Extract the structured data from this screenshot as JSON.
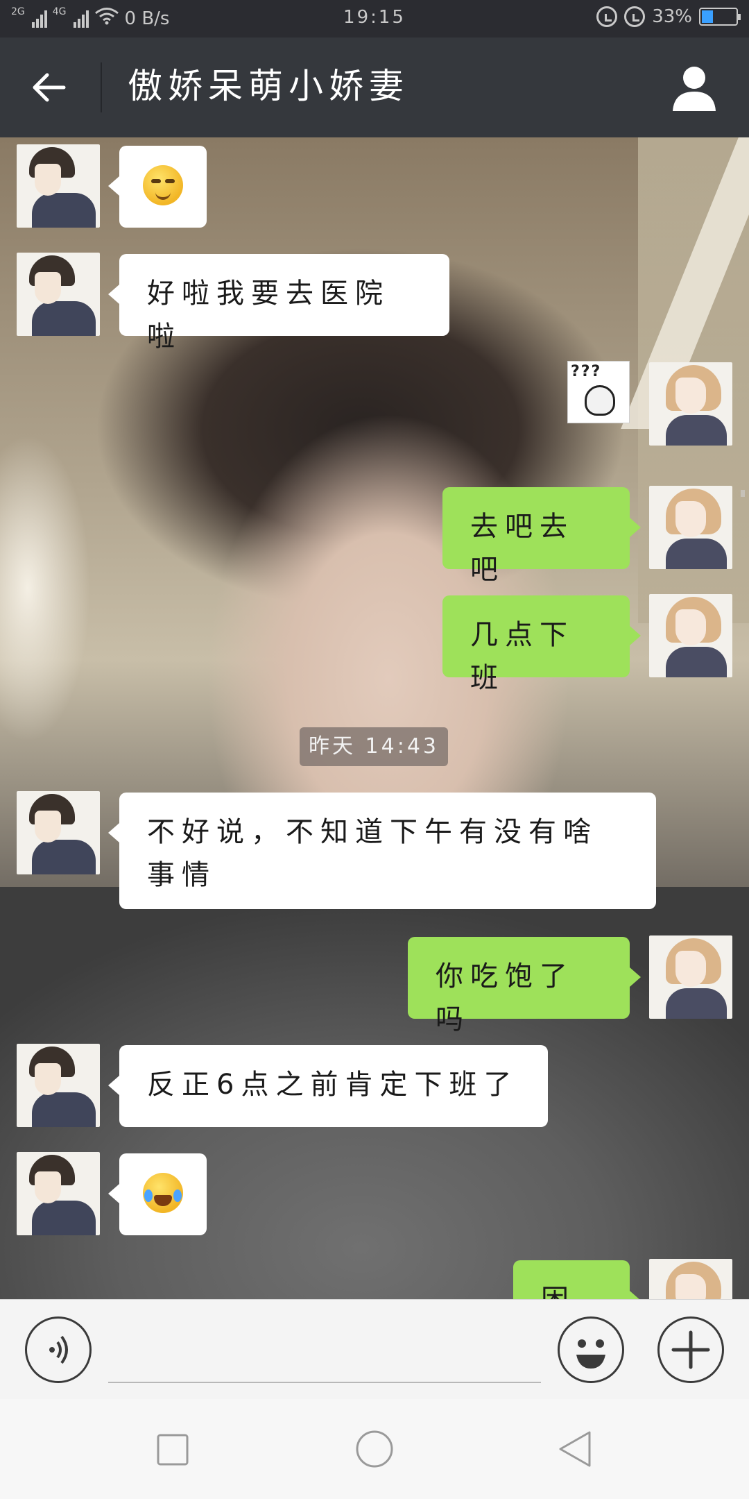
{
  "status_bar": {
    "net_type_1": "2G",
    "net_type_2": "4G",
    "speed": "0 B/s",
    "time": "19:15",
    "battery_percent": "33%",
    "battery_level": 0.33,
    "battery_color": "#3aa0ff"
  },
  "header": {
    "title": "傲娇呆萌小娇妻"
  },
  "messages": [
    {
      "side": "in",
      "type": "emoji",
      "emoji": "smirk-face"
    },
    {
      "side": "in",
      "type": "text",
      "text": "好啦我要去医院啦"
    },
    {
      "side": "out",
      "type": "sticker",
      "sticker_text": "???"
    },
    {
      "side": "out",
      "type": "text",
      "text": "去吧去吧"
    },
    {
      "side": "out",
      "type": "text",
      "text": "几点下班"
    },
    {
      "side": "in",
      "type": "text",
      "text": "不好说，不知道下午有没有啥事情"
    },
    {
      "side": "out",
      "type": "text",
      "text": "你吃饱了吗"
    },
    {
      "side": "in",
      "type": "text",
      "text": "反正6点之前肯定下班了"
    },
    {
      "side": "in",
      "type": "emoji",
      "emoji": "tears-of-joy-face"
    },
    {
      "side": "out",
      "type": "text",
      "text": "困困"
    }
  ],
  "timestamp_divider": "昨天 14:43",
  "input": {
    "value": "",
    "placeholder": ""
  },
  "colors": {
    "outgoing_bubble": "#9ee15a",
    "incoming_bubble": "#ffffff",
    "header_bg": "#35383d"
  }
}
